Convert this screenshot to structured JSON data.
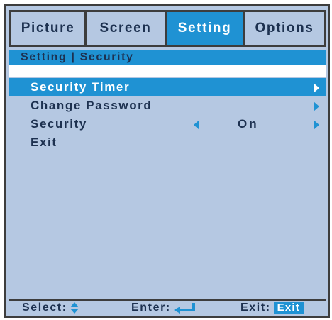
{
  "tabs": [
    {
      "label": "Picture",
      "active": false
    },
    {
      "label": "Screen",
      "active": false
    },
    {
      "label": "Setting",
      "active": true
    },
    {
      "label": "Options",
      "active": false
    }
  ],
  "breadcrumb": "Setting | Security",
  "menu": {
    "items": [
      {
        "label": "Security Timer",
        "selected": true,
        "arrow_right": true
      },
      {
        "label": "Change Password",
        "selected": false,
        "arrow_right": true
      },
      {
        "label": "Security",
        "selected": false,
        "value": "On",
        "arrow_left": true,
        "arrow_right": true
      },
      {
        "label": "Exit",
        "selected": false
      }
    ]
  },
  "footer": {
    "select_label": "Select:",
    "enter_label": "Enter:",
    "exit_label": "Exit:",
    "exit_key": "Exit"
  },
  "colors": {
    "panel_bg": "#b5c8e2",
    "accent": "#1f92d3",
    "text": "#1d3150",
    "border": "#3d3d3d"
  },
  "icons": [
    "up-down-arrow-icon",
    "enter-return-icon",
    "arrow-left-icon",
    "arrow-right-icon"
  ]
}
